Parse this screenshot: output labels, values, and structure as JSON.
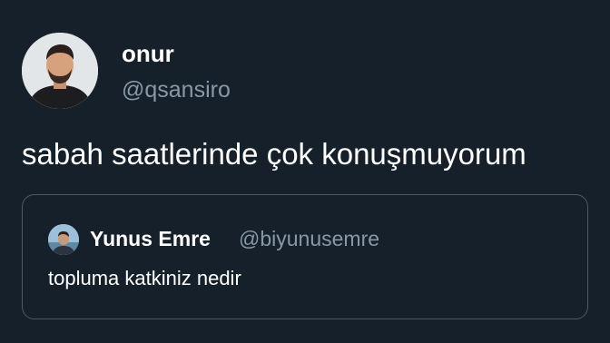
{
  "tweet": {
    "author": {
      "name": "onur",
      "handle": "@qsansiro",
      "avatar": "profile-photo"
    },
    "text": "sabah saatlerinde çok konuşmuyorum",
    "quoted_tweet": {
      "author": {
        "name": "Yunus Emre",
        "handle": "@biyunusemre",
        "avatar": "profile-photo"
      },
      "text": "topluma katkiniz nedir"
    }
  },
  "colors": {
    "background": "#15202b",
    "primary_text": "#ffffff",
    "secondary_text": "#8899a6",
    "card_border": "#4a5a69"
  }
}
